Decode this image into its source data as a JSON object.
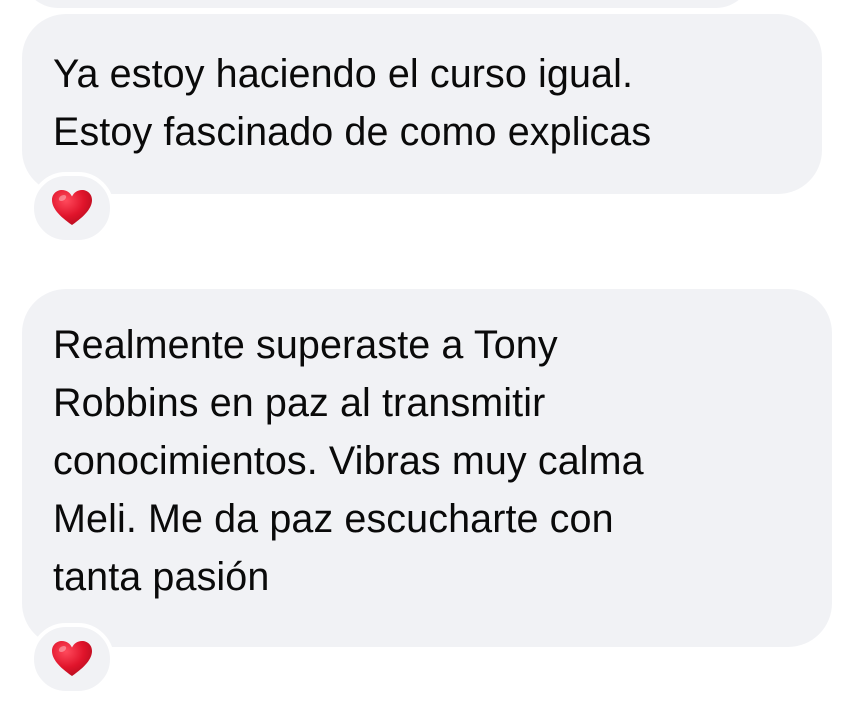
{
  "messages": [
    {
      "lines": [
        "Ya estoy haciendo el curso igual.",
        "Estoy fascinado de como explicas"
      ],
      "reaction": "heart-icon",
      "reaction_color": "#e0142b"
    },
    {
      "lines": [
        "Realmente superaste a Tony",
        "Robbins en paz al transmitir",
        "conocimientos. Vibras muy calma",
        "Meli. Me da paz escucharte con",
        "tanta pasión"
      ],
      "reaction": "heart-icon",
      "reaction_color": "#e0142b"
    }
  ],
  "colors": {
    "bubble_background": "#f1f2f5",
    "text": "#0a0a0a",
    "page_background": "#ffffff"
  }
}
